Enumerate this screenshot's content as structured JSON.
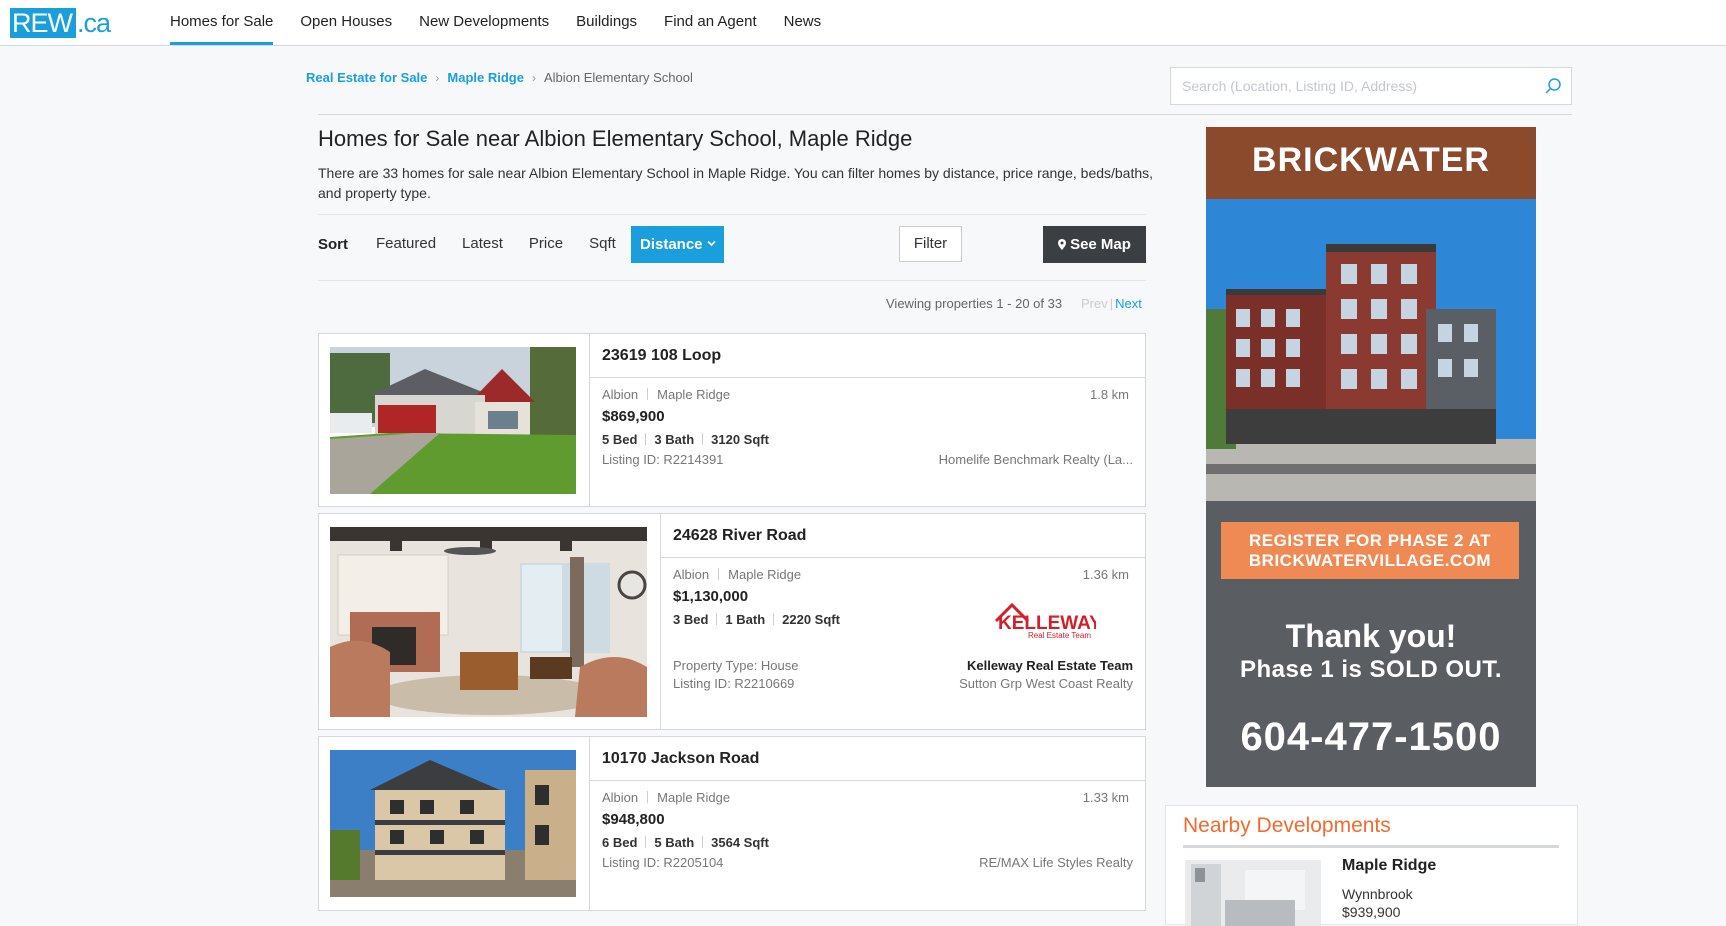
{
  "logo": {
    "main": "REW",
    "suffix": ".ca"
  },
  "nav": [
    "Homes for Sale",
    "Open Houses",
    "New Developments",
    "Buildings",
    "Find an Agent",
    "News"
  ],
  "breadcrumb": {
    "root": "Real Estate for Sale",
    "city": "Maple Ridge",
    "current": "Albion Elementary School"
  },
  "search": {
    "placeholder": "Search (Location, Listing ID, Address)"
  },
  "page": {
    "title": "Homes for Sale near Albion Elementary School, Maple Ridge",
    "description": "There are 33 homes for sale near Albion Elementary School in Maple Ridge. You can filter homes by distance, price range, beds/baths, and property type."
  },
  "sort": {
    "label": "Sort",
    "options": [
      "Featured",
      "Latest",
      "Price",
      "Sqft"
    ],
    "active": "Distance",
    "filter": "Filter",
    "map": "See Map"
  },
  "pagination": {
    "viewing": "Viewing properties 1 - 20 of 33",
    "prev": "Prev",
    "next": "Next"
  },
  "listings": [
    {
      "address": "23619 108 Loop",
      "area": "Albion",
      "city": "Maple Ridge",
      "distance": "1.8 km",
      "price": "$869,900",
      "beds": "5 Bed",
      "baths": "3 Bath",
      "sqft": "3120 Sqft",
      "listing_id": "Listing ID:  R2214391",
      "broker": "Homelife Benchmark Realty (La..."
    },
    {
      "address": "24628 River Road",
      "area": "Albion",
      "city": "Maple Ridge",
      "distance": "1.36 km",
      "price": "$1,130,000",
      "beds": "3 Bed",
      "baths": "1 Bath",
      "sqft": "2220 Sqft",
      "property_type": "Property Type:  House",
      "listing_id": "Listing ID:  R2210669",
      "agent_logo": {
        "name": "KELLEWAY",
        "tagline": "Real Estate Team"
      },
      "agent": "Kelleway Real Estate Team",
      "broker": "Sutton Grp West Coast Realty"
    },
    {
      "address": "10170 Jackson Road",
      "area": "Albion",
      "city": "Maple Ridge",
      "distance": "1.33 km",
      "price": "$948,800",
      "beds": "6 Bed",
      "baths": "5 Bath",
      "sqft": "3564 Sqft",
      "listing_id": "Listing ID:  R2205104",
      "broker": "RE/MAX Life Styles Realty"
    }
  ],
  "ad": {
    "brand": "BRICKWATER",
    "cta_line1": "REGISTER FOR PHASE 2 AT",
    "cta_line2": "BRICKWATERVILLAGE.COM",
    "thanks": "Thank you!",
    "sold": "Phase 1 is SOLD OUT.",
    "phone": "604-477-1500"
  },
  "nearby": {
    "title": "Nearby Developments",
    "city": "Maple Ridge",
    "name": "Wynnbrook",
    "price": "$939,900"
  },
  "colors": {
    "accent": "#1a9fdc",
    "dark_button": "#3b3f44",
    "nearby_title": "#f26b2e",
    "ad_cta": "#f08a54"
  }
}
